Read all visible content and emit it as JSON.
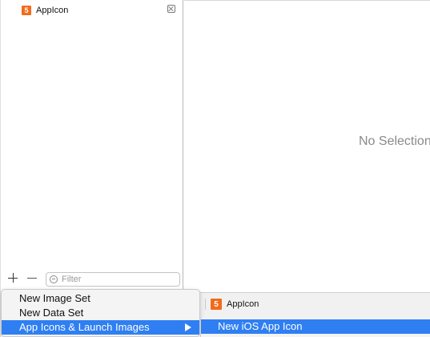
{
  "navigator": {
    "items": [
      {
        "label": "AppIcon",
        "badge": "5"
      }
    ],
    "filter_placeholder": "Filter"
  },
  "editor": {
    "empty_message": "No Selection",
    "tab": {
      "label": "AppIcon",
      "badge": "5"
    }
  },
  "context_menu": {
    "items": [
      {
        "label": "New Image Set"
      },
      {
        "label": "New Data Set"
      },
      {
        "label": "App Icons & Launch Images",
        "has_submenu": true,
        "highlighted": true
      }
    ]
  },
  "submenu": {
    "items": [
      {
        "label": "New iOS App Icon",
        "highlighted": true
      }
    ]
  },
  "colors": {
    "highlight": "#2f7ff2",
    "swift_badge": "#f26b1d"
  }
}
